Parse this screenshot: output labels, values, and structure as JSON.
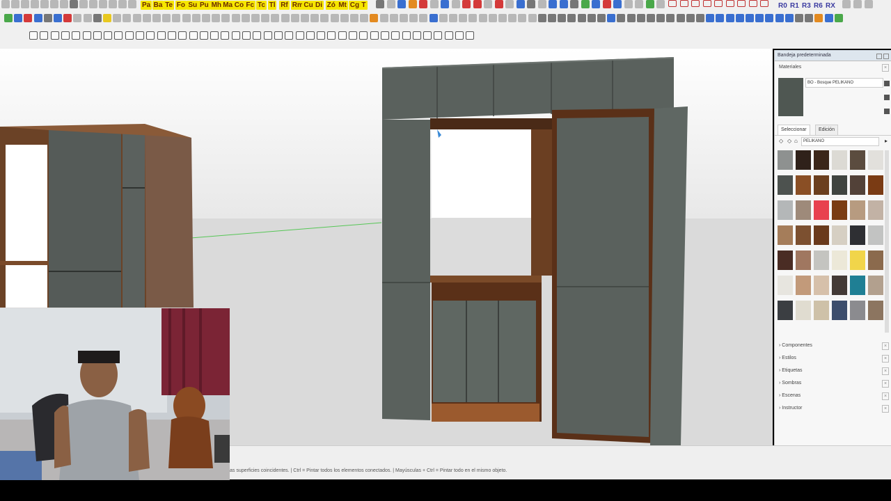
{
  "toolbar_row1": {
    "layer_buttons": [
      "Pa",
      "Ba",
      "Te",
      "Fo",
      "Su",
      "Pu",
      "Mh",
      "Ma",
      "Co",
      "Fc",
      "Tc",
      "Tl",
      "Rf",
      "Rm",
      "Cu",
      "Di",
      "Zó",
      "Mt",
      "Cg",
      "T"
    ],
    "right_buttons": [
      "R0",
      "R1",
      "R3",
      "R6",
      "RX"
    ]
  },
  "tray": {
    "title": "Bandeja predeterminada",
    "materials_header": "Materiales",
    "material_name": "BO - Bosque PELIKANO",
    "tab_select": "Seleccionar",
    "tab_edit": "Edición",
    "library": "PELIKANO",
    "sections": [
      "Componentes",
      "Estilos",
      "Etiquetas",
      "Sombras",
      "Escenas",
      "Instructor"
    ]
  },
  "swatch_colors": [
    "#8e9190",
    "#2f211a",
    "#3b2619",
    "#dcdad4",
    "#5b4c3f",
    "#e2e0dc",
    "#4d524f",
    "#8a4f25",
    "#6b3f1e",
    "#404440",
    "#524138",
    "#7a3b14",
    "#b4b7b8",
    "#9e8a7a",
    "#e8414f",
    "#7a3d13",
    "#b79b80",
    "#c2b2a5",
    "#a57d5a",
    "#7c5030",
    "#6a3a1c",
    "#d6cfc3",
    "#2e2f33",
    "#c2c3c2",
    "#4a2c24",
    "#a07760",
    "#c4c4c0",
    "#ece8d8",
    "#f1d54a",
    "#8b6a4d",
    "#e7e5df",
    "#c29a7a",
    "#d6c0aa",
    "#433a36",
    "#1f7f94",
    "#b2a08e",
    "#3b3e42",
    "#e0dcd0",
    "#cec1a8",
    "#3c4d6c",
    "#8b8b8f",
    "#8c7560"
  ],
  "status": {
    "hint": "as superficies coincidentes.  |  Ctrl = Pintar todos los elementos conectados.  |  Mayúsculas + Ctrl = Pintar todo en el mismo objeto."
  }
}
